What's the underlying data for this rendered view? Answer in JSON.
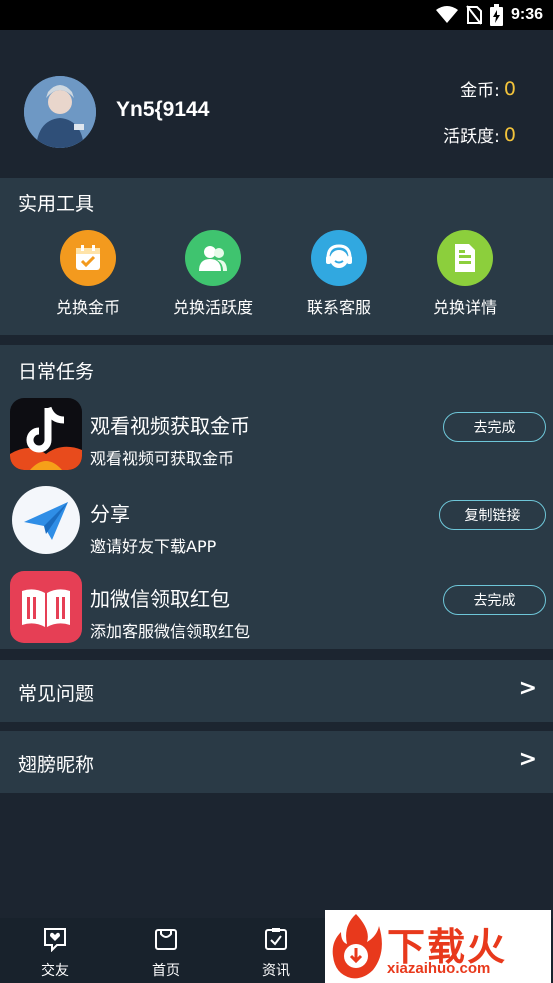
{
  "status_bar": {
    "time": "9:36",
    "icons": [
      "wifi-icon",
      "no-sim-icon",
      "battery-charging-icon"
    ]
  },
  "profile": {
    "username": "Yn5{9144",
    "coins_label": "金币:",
    "coins_value": "0",
    "activity_label": "活跃度:",
    "activity_value": "0",
    "accent_color": "#f3c43b"
  },
  "tools": {
    "title": "实用工具",
    "items": [
      {
        "label": "兑换金币",
        "icon": "calendar-check-icon",
        "color": "#f39a1e"
      },
      {
        "label": "兑换活跃度",
        "icon": "users-icon",
        "color": "#3fc46f"
      },
      {
        "label": "联系客服",
        "icon": "headset-icon",
        "color": "#31a8e0"
      },
      {
        "label": "兑换详情",
        "icon": "document-icon",
        "color": "#8ccf3c"
      }
    ]
  },
  "daily_tasks": {
    "title": "日常任务",
    "items": [
      {
        "title": "观看视频获取金币",
        "subtitle": "观看视频可获取金币",
        "button": "去完成",
        "icon": "tiktok-icon"
      },
      {
        "title": "分享",
        "subtitle": "邀请好友下载APP",
        "button": "复制链接",
        "icon": "paper-plane-icon"
      },
      {
        "title": "加微信领取红包",
        "subtitle": "添加客服微信领取红包",
        "button": "去完成",
        "icon": "book-icon"
      }
    ]
  },
  "menu_rows": [
    {
      "label": "常见问题",
      "arrow": ">"
    },
    {
      "label": "翅膀昵称",
      "arrow": ">"
    }
  ],
  "bottom_nav": [
    {
      "label": "交友",
      "icon": "heart-chat-icon"
    },
    {
      "label": "首页",
      "icon": "bag-icon"
    },
    {
      "label": "资讯",
      "icon": "clipboard-check-icon"
    }
  ],
  "watermark": {
    "title": "下载火",
    "url": "xiazaihuo.com"
  }
}
